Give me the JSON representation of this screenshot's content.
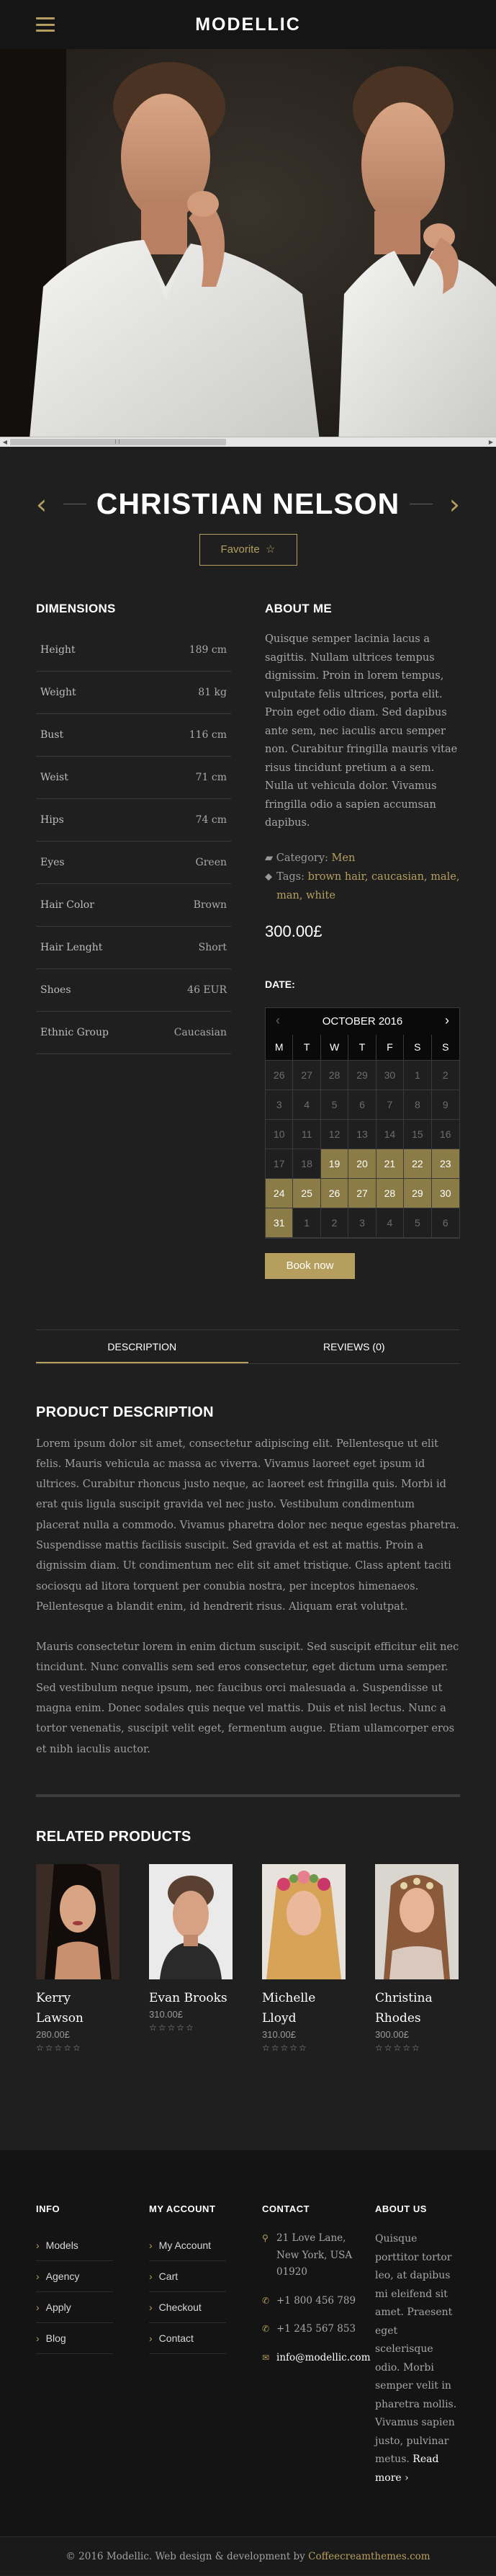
{
  "header": {
    "logo": "MODELLIC"
  },
  "model": {
    "name": "CHRISTIAN NELSON",
    "favorite_label": "Favorite",
    "favorite_icon": "☆"
  },
  "dimensions": {
    "title": "DIMENSIONS",
    "rows": [
      {
        "k": "Height",
        "v": "189 cm"
      },
      {
        "k": "Weight",
        "v": "81 kg"
      },
      {
        "k": "Bust",
        "v": "116 cm"
      },
      {
        "k": "Weist",
        "v": "71 cm"
      },
      {
        "k": "Hips",
        "v": "74 cm"
      },
      {
        "k": "Eyes",
        "v": "Green"
      },
      {
        "k": "Hair Color",
        "v": "Brown"
      },
      {
        "k": "Hair Lenght",
        "v": "Short"
      },
      {
        "k": "Shoes",
        "v": "46 EUR"
      },
      {
        "k": "Ethnic Group",
        "v": "Caucasian"
      }
    ]
  },
  "about": {
    "title": "ABOUT ME",
    "text": "Quisque semper lacinia lacus a sagittis. Nullam ultrices tempus dignissim. Proin in lorem tempus, vulputate felis ultrices, porta elit. Proin eget odio diam. Sed dapibus ante sem, nec iaculis arcu semper non. Curabitur fringilla mauris vitae risus tincidunt pretium a a sem. Nulla ut vehicula dolor. Vivamus fringilla odio a sapien accumsan dapibus.",
    "category_label": "Category:",
    "category": "Men",
    "tags_label": "Tags:",
    "tags": "brown hair, caucasian, male, man, white",
    "price": "300.00£"
  },
  "calendar": {
    "date_label": "DATE:",
    "month": "OCTOBER 2016",
    "prev": "‹",
    "next": "›",
    "dow": [
      "M",
      "T",
      "W",
      "T",
      "F",
      "S",
      "S"
    ],
    "days": [
      {
        "d": "26",
        "s": "off"
      },
      {
        "d": "27",
        "s": "off"
      },
      {
        "d": "28",
        "s": "off"
      },
      {
        "d": "29",
        "s": "off"
      },
      {
        "d": "30",
        "s": "off"
      },
      {
        "d": "1",
        "s": "off"
      },
      {
        "d": "2",
        "s": "off"
      },
      {
        "d": "3",
        "s": "off"
      },
      {
        "d": "4",
        "s": "off"
      },
      {
        "d": "5",
        "s": "off"
      },
      {
        "d": "6",
        "s": "off"
      },
      {
        "d": "7",
        "s": "off"
      },
      {
        "d": "8",
        "s": "off"
      },
      {
        "d": "9",
        "s": "off"
      },
      {
        "d": "10",
        "s": "off"
      },
      {
        "d": "11",
        "s": "off"
      },
      {
        "d": "12",
        "s": "off"
      },
      {
        "d": "13",
        "s": "off"
      },
      {
        "d": "14",
        "s": "off"
      },
      {
        "d": "15",
        "s": "off"
      },
      {
        "d": "16",
        "s": "off"
      },
      {
        "d": "17",
        "s": "off"
      },
      {
        "d": "18",
        "s": "off"
      },
      {
        "d": "19",
        "s": "on"
      },
      {
        "d": "20",
        "s": "on"
      },
      {
        "d": "21",
        "s": "on"
      },
      {
        "d": "22",
        "s": "on"
      },
      {
        "d": "23",
        "s": "on"
      },
      {
        "d": "24",
        "s": "on"
      },
      {
        "d": "25",
        "s": "on"
      },
      {
        "d": "26",
        "s": "on"
      },
      {
        "d": "27",
        "s": "on"
      },
      {
        "d": "28",
        "s": "on"
      },
      {
        "d": "29",
        "s": "on"
      },
      {
        "d": "30",
        "s": "on"
      },
      {
        "d": "31",
        "s": "on"
      },
      {
        "d": "1",
        "s": "off"
      },
      {
        "d": "2",
        "s": "off"
      },
      {
        "d": "3",
        "s": "off"
      },
      {
        "d": "4",
        "s": "off"
      },
      {
        "d": "5",
        "s": "off"
      },
      {
        "d": "6",
        "s": "off"
      }
    ],
    "book_label": "Book now"
  },
  "tabs": [
    {
      "label": "DESCRIPTION",
      "active": true
    },
    {
      "label": "REVIEWS (0)",
      "active": false
    }
  ],
  "description": {
    "title": "PRODUCT DESCRIPTION",
    "p1": "Lorem ipsum dolor sit amet, consectetur adipiscing elit. Pellentesque ut elit felis. Mauris vehicula ac massa ac viverra. Vivamus laoreet eget ipsum id ultrices. Curabitur rhoncus justo neque, ac laoreet est fringilla quis. Morbi id erat quis ligula suscipit gravida vel nec justo. Vestibulum condimentum placerat nulla a commodo. Vivamus pharetra dolor nec neque egestas pharetra. Suspendisse mattis facilisis suscipit. Sed gravida et est at mattis. Proin a dignissim diam. Ut condimentum nec elit sit amet tristique. Class aptent taciti sociosqu ad litora torquent per conubia nostra, per inceptos himenaeos. Pellentesque a blandit enim, id hendrerit risus. Aliquam erat volutpat.",
    "p2": "Mauris consectetur lorem in enim dictum suscipit. Sed suscipit efficitur elit nec tincidunt. Nunc convallis sem sed eros consectetur, eget dictum urna semper. Sed vestibulum neque ipsum, nec faucibus orci malesuada a. Suspendisse ut magna enim. Donec sodales quis neque vel mattis. Duis et nisl lectus. Nunc a tortor venenatis, suscipit velit eget, fermentum augue. Etiam ullamcorper eros et nibh iaculis auctor."
  },
  "related": {
    "title": "RELATED PRODUCTS",
    "items": [
      {
        "name": "Kerry Lawson",
        "price": "280.00£",
        "stars": "☆☆☆☆☆"
      },
      {
        "name": "Evan Brooks",
        "price": "310.00£",
        "stars": "☆☆☆☆☆"
      },
      {
        "name": "Michelle Lloyd",
        "price": "310.00£",
        "stars": "☆☆☆☆☆"
      },
      {
        "name": "Christina Rhodes",
        "price": "300.00£",
        "stars": "☆☆☆☆☆"
      }
    ]
  },
  "footer": {
    "info": {
      "title": "INFO",
      "links": [
        "Models",
        "Agency",
        "Apply",
        "Blog"
      ]
    },
    "account": {
      "title": "MY ACCOUNT",
      "links": [
        "My Account",
        "Cart",
        "Checkout",
        "Contact"
      ]
    },
    "contact": {
      "title": "CONTACT",
      "address": "21 Love Lane, New York, USA 01920",
      "phone1": "+1 800 456 789",
      "phone2": "+1 245 567 853",
      "email": "info@modellic.com"
    },
    "about": {
      "title": "ABOUT US",
      "text": "Quisque porttitor tortor leo, at dapibus mi eleifend sit amet. Praesent eget scelerisque odio. Morbi semper velit in pharetra mollis. Vivamus sapien justo, pulvinar metus.",
      "more": "Read more ›"
    }
  },
  "bottom": {
    "prefix": "© 2016 Modellic. Web design & development by",
    "brand": "Coffeecreamthemes.com"
  },
  "colors": {
    "accent": "#b69f5e",
    "bg": "#1f1f1f",
    "footer": "#141414",
    "booked": "#8b7c47"
  }
}
